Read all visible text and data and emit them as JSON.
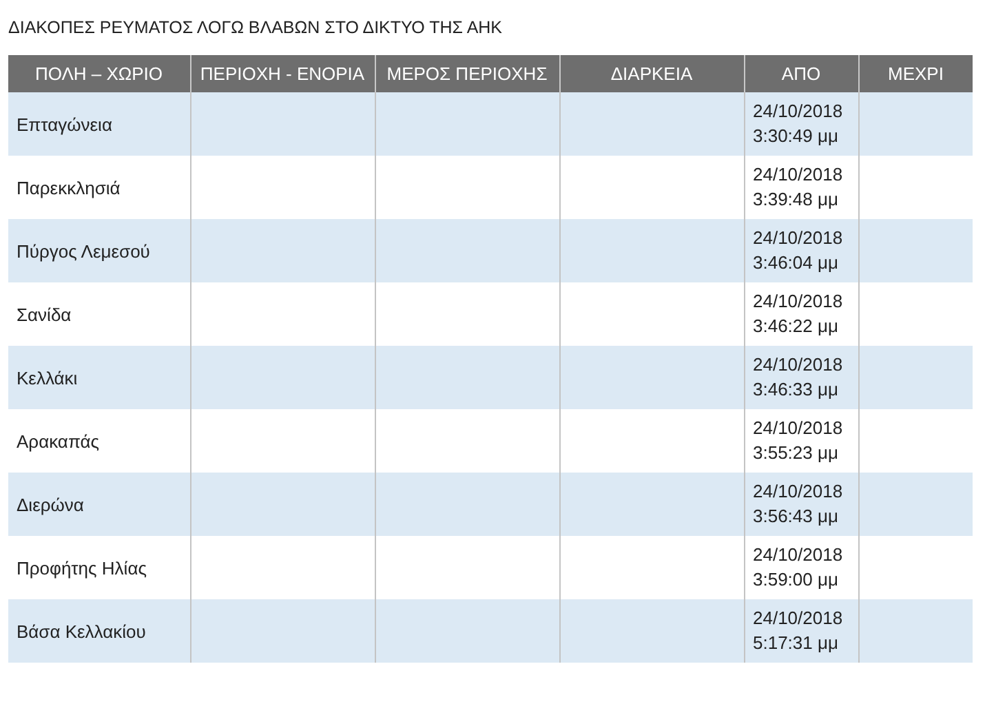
{
  "title": "ΔΙΑΚΟΠΕΣ ΡΕΥΜΑΤΟΣ ΛΟΓΩ ΒΛΑΒΩΝ ΣΤΟ ΔΙΚΤΥΟ ΤΗΣ ΑΗΚ",
  "table": {
    "columns": [
      "ΠΟΛΗ – ΧΩΡΙΟ",
      "ΠΕΡΙΟΧΗ - ΕΝΟΡΙΑ",
      "ΜΕΡΟΣ ΠΕΡΙΟΧΗΣ",
      "ΔΙΑΡΚΕΙΑ",
      "ΑΠΟ",
      "ΜΕΧΡΙ"
    ],
    "rows": [
      {
        "city": "Επταγώνεια",
        "from": "24/10/2018 3:30:49 μμ"
      },
      {
        "city": "Παρεκκλησιά",
        "from": "24/10/2018 3:39:48 μμ"
      },
      {
        "city": "Πύργος Λεμεσού",
        "from": "24/10/2018 3:46:04 μμ"
      },
      {
        "city": "Σανίδα",
        "from": "24/10/2018 3:46:22 μμ"
      },
      {
        "city": "Κελλάκι",
        "from": "24/10/2018 3:46:33 μμ"
      },
      {
        "city": "Αρακαπάς",
        "from": "24/10/2018 3:55:23 μμ"
      },
      {
        "city": "Διερώνα",
        "from": "24/10/2018 3:56:43 μμ"
      },
      {
        "city": "Προφήτης Ηλίας",
        "from": "24/10/2018 3:59:00 μμ"
      },
      {
        "city": "Βάσα Κελλακίου",
        "from": "24/10/2018 5:17:31 μμ"
      }
    ]
  }
}
